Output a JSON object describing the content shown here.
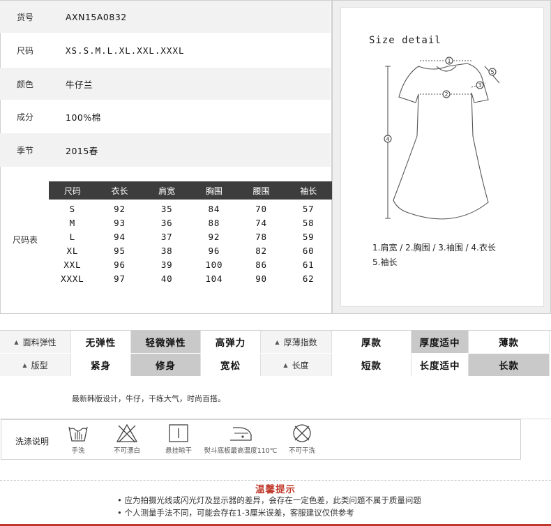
{
  "product": {
    "rows": [
      {
        "label": "货号",
        "value": "AXN15A0832"
      },
      {
        "label": "尺码",
        "value": "XS.S.M.L.XL.XXL.XXXL"
      },
      {
        "label": "颜色",
        "value": "牛仔兰"
      },
      {
        "label": "成分",
        "value": "100%棉"
      },
      {
        "label": "季节",
        "value": "2015春"
      }
    ]
  },
  "size_chart": {
    "label": "尺码表",
    "headers": [
      "尺码",
      "衣长",
      "肩宽",
      "胸围",
      "腰围",
      "袖长"
    ],
    "rows": [
      [
        "S",
        "92",
        "35",
        "84",
        "70",
        "57"
      ],
      [
        "M",
        "93",
        "36",
        "88",
        "74",
        "58"
      ],
      [
        "L",
        "94",
        "37",
        "92",
        "78",
        "59"
      ],
      [
        "XL",
        "95",
        "38",
        "96",
        "82",
        "60"
      ],
      [
        "XXL",
        "96",
        "39",
        "100",
        "86",
        "61"
      ],
      [
        "XXXL",
        "97",
        "40",
        "104",
        "90",
        "62"
      ]
    ]
  },
  "size_detail": {
    "title": "Size detail",
    "markers": [
      "1",
      "2",
      "3",
      "4",
      "5"
    ],
    "legend_line1": "1.肩宽 / 2.胸围 / 3.袖围 / 4.衣长",
    "legend_line2": "5.袖长"
  },
  "attributes": {
    "elasticity": {
      "label": "面料弹性",
      "options": [
        "无弹性",
        "轻微弹性",
        "高弹力"
      ],
      "selected": "轻微弹性"
    },
    "thickness": {
      "label": "厚薄指数",
      "options": [
        "厚款",
        "厚度适中",
        "薄款"
      ],
      "selected": "厚度适中"
    },
    "fit": {
      "label": "版型",
      "options": [
        "紧身",
        "修身",
        "宽松"
      ],
      "selected": "修身"
    },
    "length": {
      "label": "长度",
      "options": [
        "短款",
        "长度适中",
        "长款"
      ],
      "selected": "长款"
    }
  },
  "description": "最新韩版设计，牛仔，干练大气，时尚百搭。",
  "washing": {
    "label": "洗涤说明",
    "items": [
      {
        "icon": "hand-wash-icon",
        "caption": "手洗"
      },
      {
        "icon": "no-bleach-icon",
        "caption": "不可漂白"
      },
      {
        "icon": "hang-dry-icon",
        "caption": "悬挂晾干"
      },
      {
        "icon": "iron-icon",
        "caption": "熨斗底板最高温度110℃"
      },
      {
        "icon": "no-dry-clean-icon",
        "caption": "不可干洗"
      }
    ]
  },
  "notice": {
    "title": "温馨提示",
    "lines": [
      "• 应为拍摄光线或闪光灯及显示器的差异，会存在一定色差，此类问题不属于质量问题",
      "• 个人测量手法不同，可能会存在1-3厘米误差，客服建议仅供参考"
    ]
  },
  "colors": {
    "accent": "#c0392b",
    "table_header": "#3d3d3d",
    "selected": "#c9c9c9"
  }
}
